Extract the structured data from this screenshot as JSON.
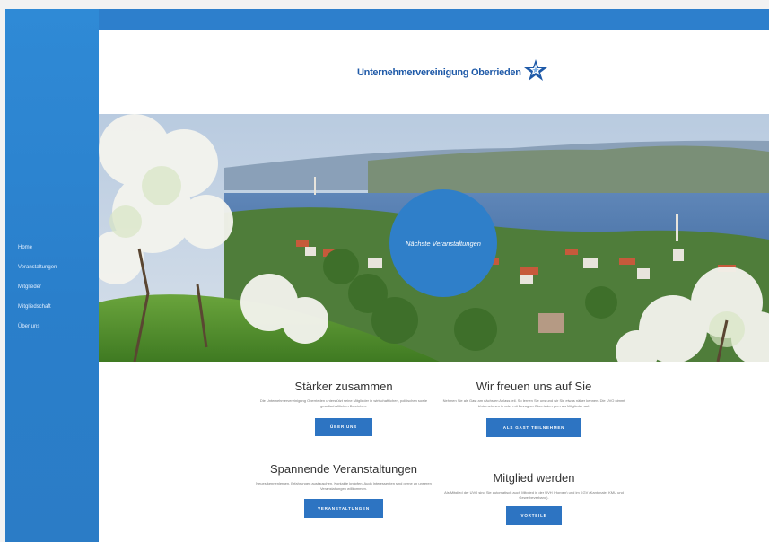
{
  "sidebar": {
    "items": [
      {
        "label": "Home"
      },
      {
        "label": "Veranstaltungen"
      },
      {
        "label": "Mitglieder"
      },
      {
        "label": "Mitgliedschaft"
      },
      {
        "label": "Über uns"
      }
    ]
  },
  "header": {
    "logo_text": "Unternehmervereinigung Oberrieden"
  },
  "hero": {
    "circle_label": "Nächste Veranstaltungen"
  },
  "sections": [
    {
      "title": "Stärker zusammen",
      "text": "Die Unternehmervereinigung Oberrieden unterstützt seine Mitglieder in wirtschaftlichen, politischen sowie gesellschaftlichen Bereichen.",
      "button": "ÜBER UNS"
    },
    {
      "title": "Wir freuen uns auf Sie",
      "text": "Nehmen Sie als Gast am nächsten Anlass teil. So lernen Sie uns und wir Sie etwas näher kennen. Die UVO nimmt Unternehmen in oder mit Bezug zu Oberrieden gern als Mitglieder auf.",
      "button": "ALS GAST TEILNEHMEN"
    },
    {
      "title": "Spannende Veranstaltungen",
      "text": "Neues kennenlernen. Erfahrungen austauschen. Kontakte knüpfen. Auch Interessenten sind gerne an unseren Veranstaltungen willkommen.",
      "button": "VERANSTALTUNGEN"
    },
    {
      "title": "Mitglied werden",
      "text": "Als Mitglied der UVO sind Sie automatisch auch Mitglied in der UVH (Horgen) und im KGV (Kantonaler KMU und Gewerbeverband).",
      "button": "VORTEILE"
    }
  ],
  "colors": {
    "primary": "#2d7fcc",
    "sidebar": "#2f8ad6",
    "button": "#2d74c2",
    "logo_text": "#1f5aa8"
  },
  "icons": {
    "logo_star": "star-logo-icon"
  }
}
